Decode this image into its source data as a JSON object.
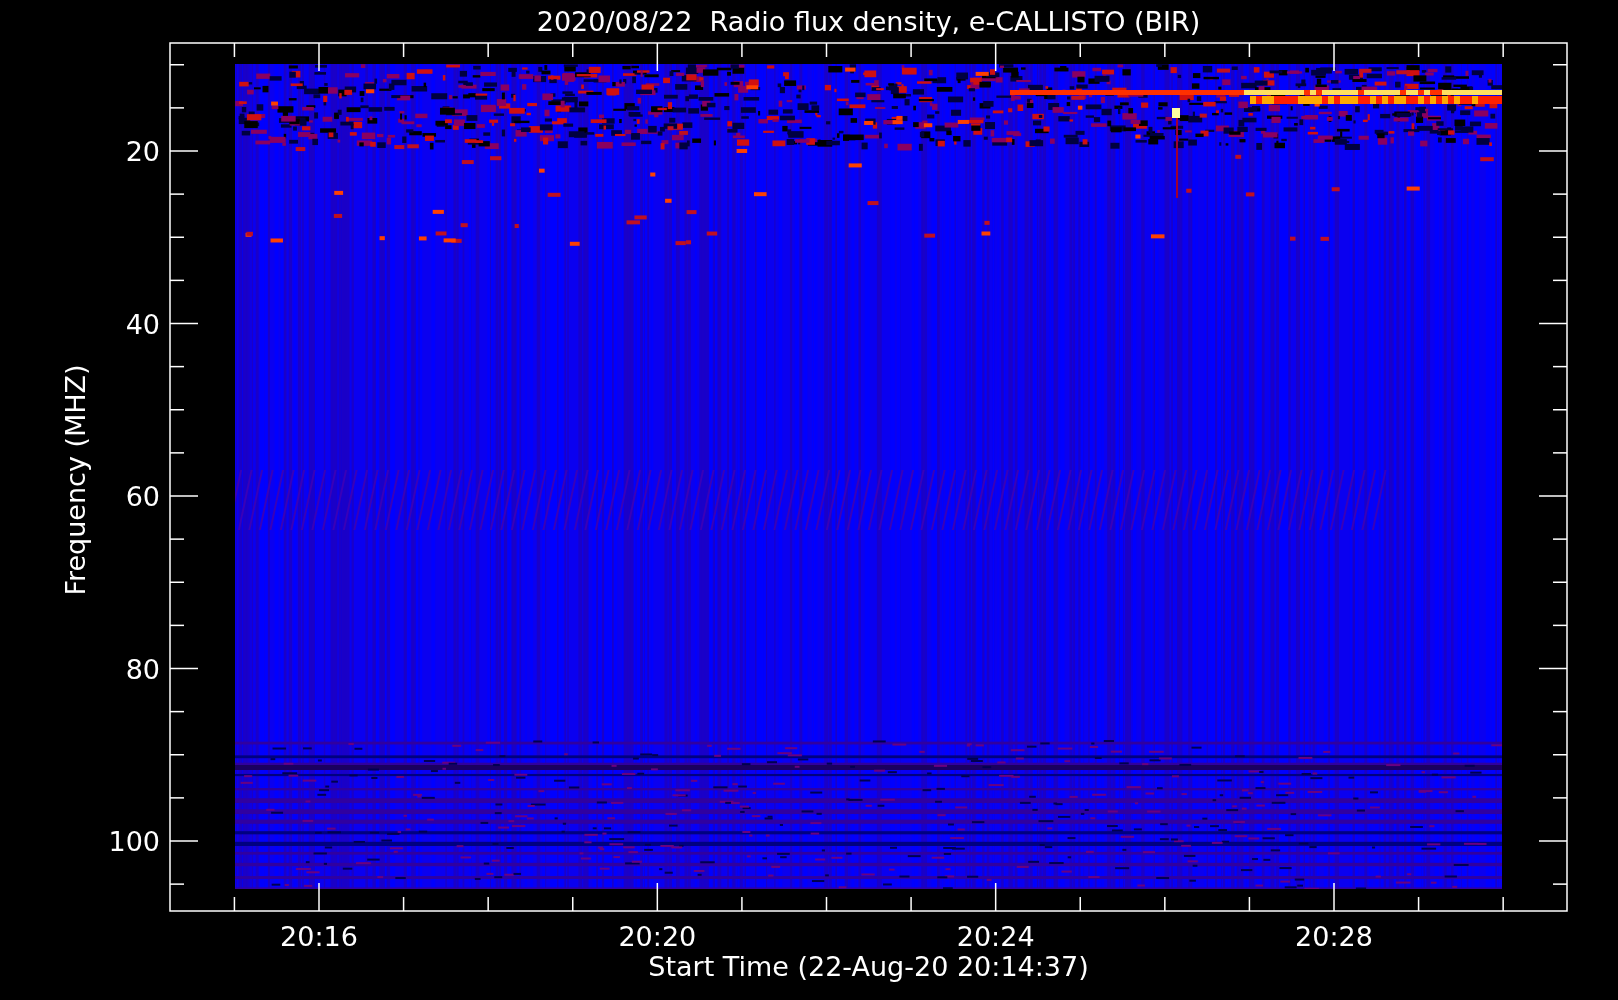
{
  "title": "2020/08/22  Radio flux density, e-CALLISTO (BIR)",
  "y_axis": {
    "label": "Frequency (MHZ)",
    "ticks": [
      "20",
      "40",
      "60",
      "80",
      "100"
    ]
  },
  "x_axis": {
    "label": "Start Time (22-Aug-20 20:14:37)",
    "ticks": [
      "20:16",
      "20:20",
      "20:24",
      "20:28"
    ]
  }
}
